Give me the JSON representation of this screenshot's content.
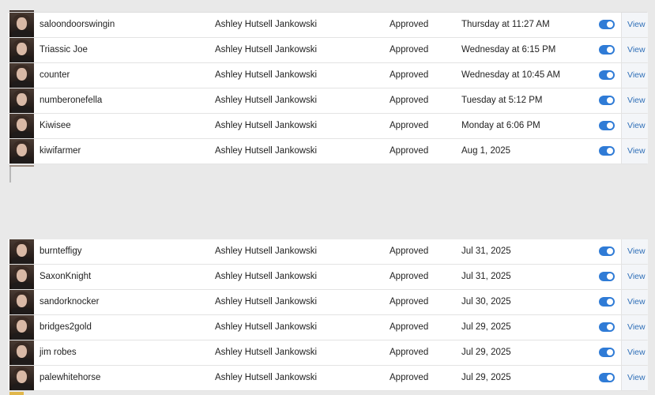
{
  "colors": {
    "toggle_on": "#2f7bd6",
    "link": "#2f6fb8",
    "background": "#e9e9e9"
  },
  "icons": {
    "avatar": "avatar-icon",
    "toggle": "toggle-switch"
  },
  "top_rows": [
    {
      "username": "saloondoorswingin",
      "moderator": "Ashley Hutsell Jankowski",
      "status": "Approved",
      "date": "Thursday at 11:27 AM",
      "action": "View"
    },
    {
      "username": "Triassic Joe",
      "moderator": "Ashley Hutsell Jankowski",
      "status": "Approved",
      "date": "Wednesday at 6:15 PM",
      "action": "View"
    },
    {
      "username": "counter",
      "moderator": "Ashley Hutsell Jankowski",
      "status": "Approved",
      "date": "Wednesday at 10:45 AM",
      "action": "View"
    },
    {
      "username": "numberonefella",
      "moderator": "Ashley Hutsell Jankowski",
      "status": "Approved",
      "date": "Tuesday at 5:12 PM",
      "action": "View"
    },
    {
      "username": "Kiwisee",
      "moderator": "Ashley Hutsell Jankowski",
      "status": "Approved",
      "date": "Monday at 6:06 PM",
      "action": "View"
    },
    {
      "username": "kiwifarmer",
      "moderator": "Ashley Hutsell Jankowski",
      "status": "Approved",
      "date": "Aug 1, 2025",
      "action": "View"
    }
  ],
  "bottom_rows": [
    {
      "username": "burnteffigy",
      "moderator": "Ashley Hutsell Jankowski",
      "status": "Approved",
      "date": "Jul 31, 2025",
      "action": "View"
    },
    {
      "username": "SaxonKnight",
      "moderator": "Ashley Hutsell Jankowski",
      "status": "Approved",
      "date": "Jul 31, 2025",
      "action": "View"
    },
    {
      "username": "sandorknocker",
      "moderator": "Ashley Hutsell Jankowski",
      "status": "Approved",
      "date": "Jul 30, 2025",
      "action": "View"
    },
    {
      "username": "bridges2gold",
      "moderator": "Ashley Hutsell Jankowski",
      "status": "Approved",
      "date": "Jul 29, 2025",
      "action": "View"
    },
    {
      "username": "jim robes",
      "moderator": "Ashley Hutsell Jankowski",
      "status": "Approved",
      "date": "Jul 29, 2025",
      "action": "View"
    },
    {
      "username": "palewhitehorse",
      "moderator": "Ashley Hutsell Jankowski",
      "status": "Approved",
      "date": "Jul 29, 2025",
      "action": "View"
    }
  ]
}
